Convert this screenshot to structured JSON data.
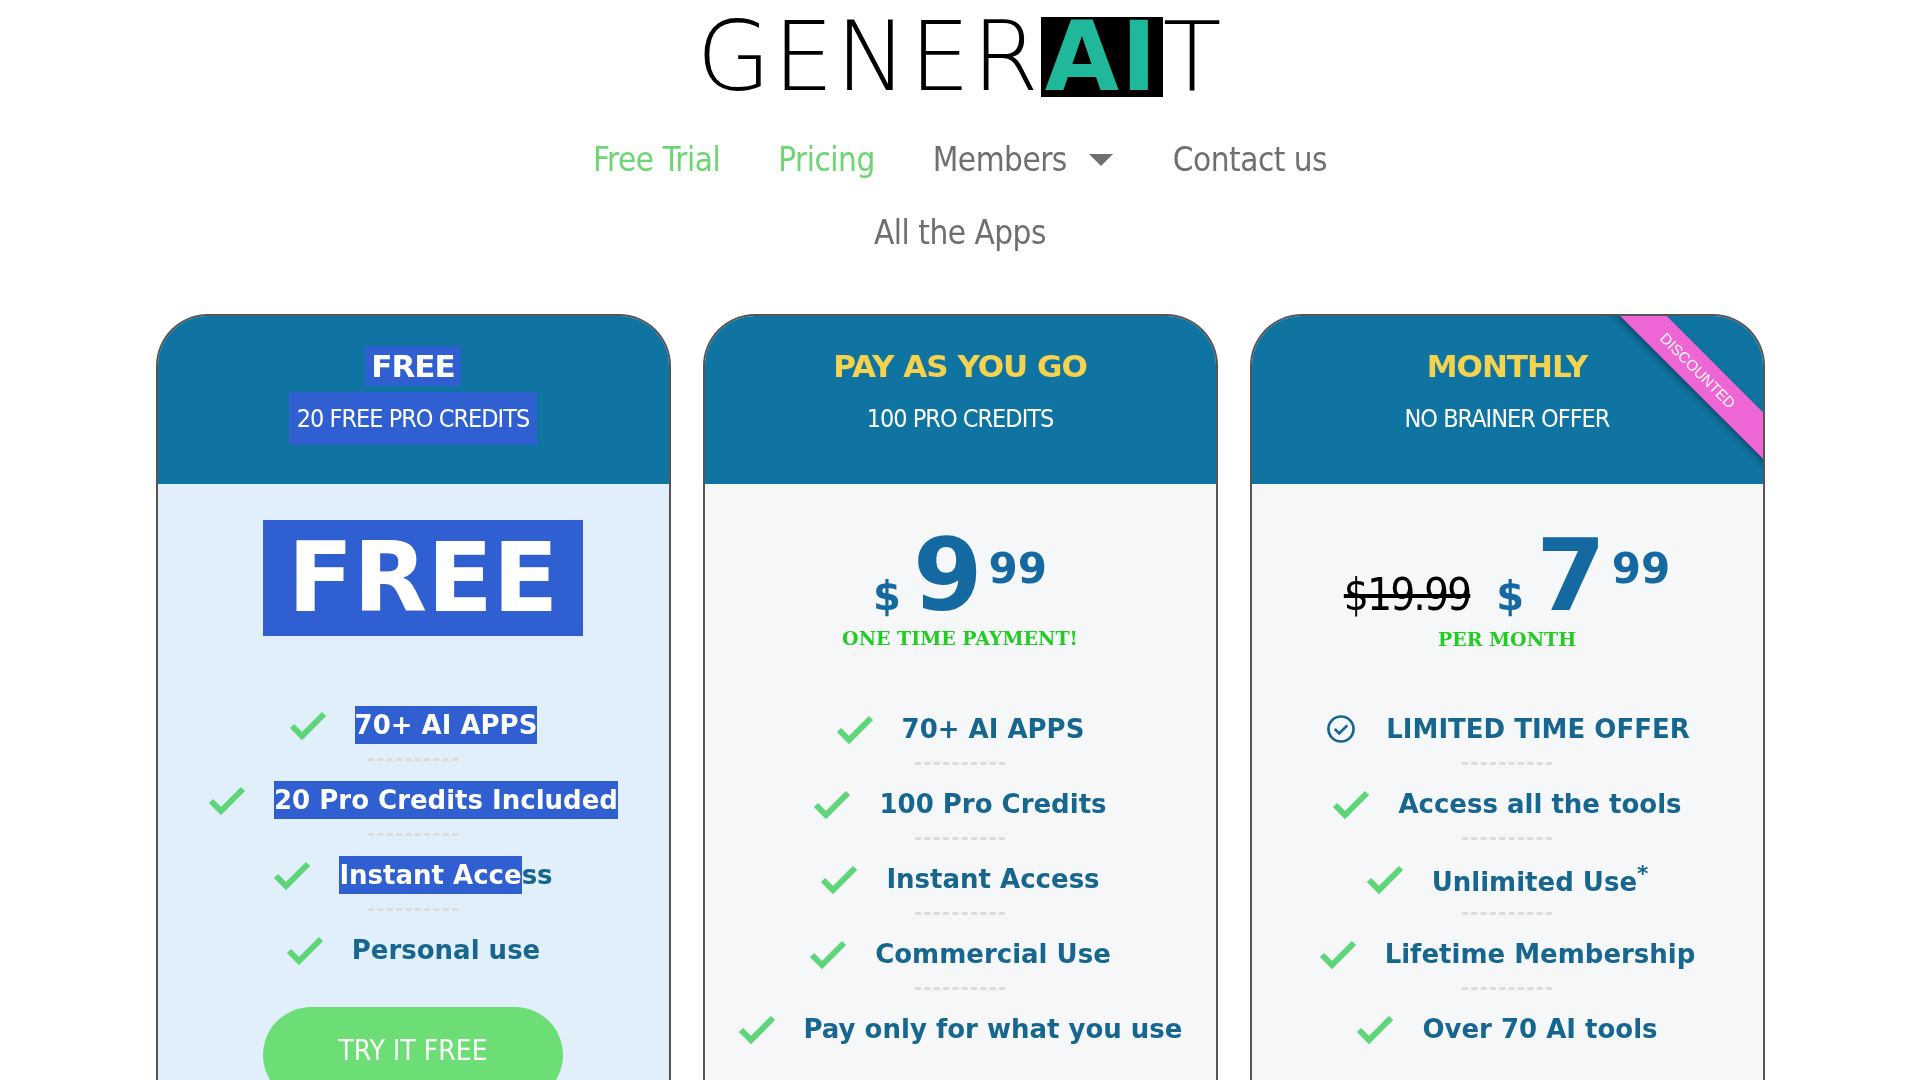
{
  "logo": {
    "parts": [
      {
        "text": "GENER",
        "boxed": false
      },
      {
        "text": "AI",
        "boxed": true
      },
      {
        "text": "T",
        "boxed": false
      }
    ]
  },
  "nav": {
    "items": [
      {
        "label": "Free Trial",
        "selected": true,
        "has_menu": false
      },
      {
        "label": "Pricing",
        "selected": true,
        "has_menu": false
      },
      {
        "label": "Members",
        "selected": false,
        "has_menu": true
      },
      {
        "label": "Contact us",
        "selected": false,
        "has_menu": false
      }
    ],
    "second_row": [
      {
        "label": "All the Apps",
        "selected": false,
        "has_menu": false
      }
    ]
  },
  "cards": [
    {
      "kind": "free",
      "title": {
        "text": "FREE",
        "highlighted": true
      },
      "subtitle": {
        "text": "20 FREE PRO CREDITS",
        "highlighted": true
      },
      "price": {
        "kind": "badge",
        "text": "FREE",
        "highlighted": true
      },
      "features": [
        {
          "kind": "check",
          "parts": [
            {
              "text": "70+ AI APPS",
              "highlighted": true
            }
          ]
        },
        {
          "kind": "check",
          "parts": [
            {
              "text": "20 Pro Credits Included",
              "highlighted": true
            }
          ]
        },
        {
          "kind": "check",
          "parts": [
            {
              "text": "Instant Acce",
              "highlighted": true
            },
            {
              "text": "ss",
              "highlighted": false
            }
          ]
        },
        {
          "kind": "check",
          "parts": [
            {
              "text": "Personal use",
              "highlighted": false
            }
          ]
        }
      ],
      "button": "TRY IT FREE"
    },
    {
      "kind": "paid",
      "title": {
        "text": "PAY AS YOU GO",
        "highlighted": false
      },
      "subtitle": {
        "text": "100 PRO CREDITS",
        "highlighted": false
      },
      "price": {
        "kind": "amount",
        "currency": "$",
        "whole": "9",
        "cents": "99",
        "note": "ONE TIME PAYMENT!"
      },
      "features": [
        {
          "kind": "check",
          "parts": [
            {
              "text": "70+ AI APPS",
              "highlighted": false
            }
          ]
        },
        {
          "kind": "check",
          "parts": [
            {
              "text": "100 Pro Credits",
              "highlighted": false
            }
          ]
        },
        {
          "kind": "check",
          "parts": [
            {
              "text": "Instant Access",
              "highlighted": false
            }
          ]
        },
        {
          "kind": "check",
          "parts": [
            {
              "text": "Commercial Use",
              "highlighted": false
            }
          ]
        },
        {
          "kind": "check",
          "parts": [
            {
              "text": "Pay only for what you use",
              "highlighted": false
            }
          ]
        }
      ]
    },
    {
      "kind": "paid",
      "title": {
        "text": "MONTHLY",
        "highlighted": false
      },
      "subtitle": {
        "text": "NO BRAINER OFFER",
        "highlighted": false
      },
      "ribbon": "DISCOUNTED",
      "price": {
        "kind": "amount",
        "old_price": "$19.99",
        "currency": "$",
        "whole": "7",
        "cents": "99",
        "note": "PER MONTH"
      },
      "features": [
        {
          "kind": "circle-check",
          "parts": [
            {
              "text": "LIMITED TIME OFFER",
              "highlighted": false
            }
          ]
        },
        {
          "kind": "check",
          "parts": [
            {
              "text": "Access all the tools",
              "highlighted": false
            }
          ]
        },
        {
          "kind": "check",
          "parts": [
            {
              "text": "Unlimited Use$^{*}$",
              "highlighted": false
            }
          ]
        },
        {
          "kind": "check",
          "parts": [
            {
              "text": "Lifetime Membership",
              "highlighted": false
            }
          ]
        },
        {
          "kind": "check",
          "parts": [
            {
              "text": "Over 70 AI tools",
              "highlighted": false
            }
          ]
        }
      ]
    }
  ]
}
